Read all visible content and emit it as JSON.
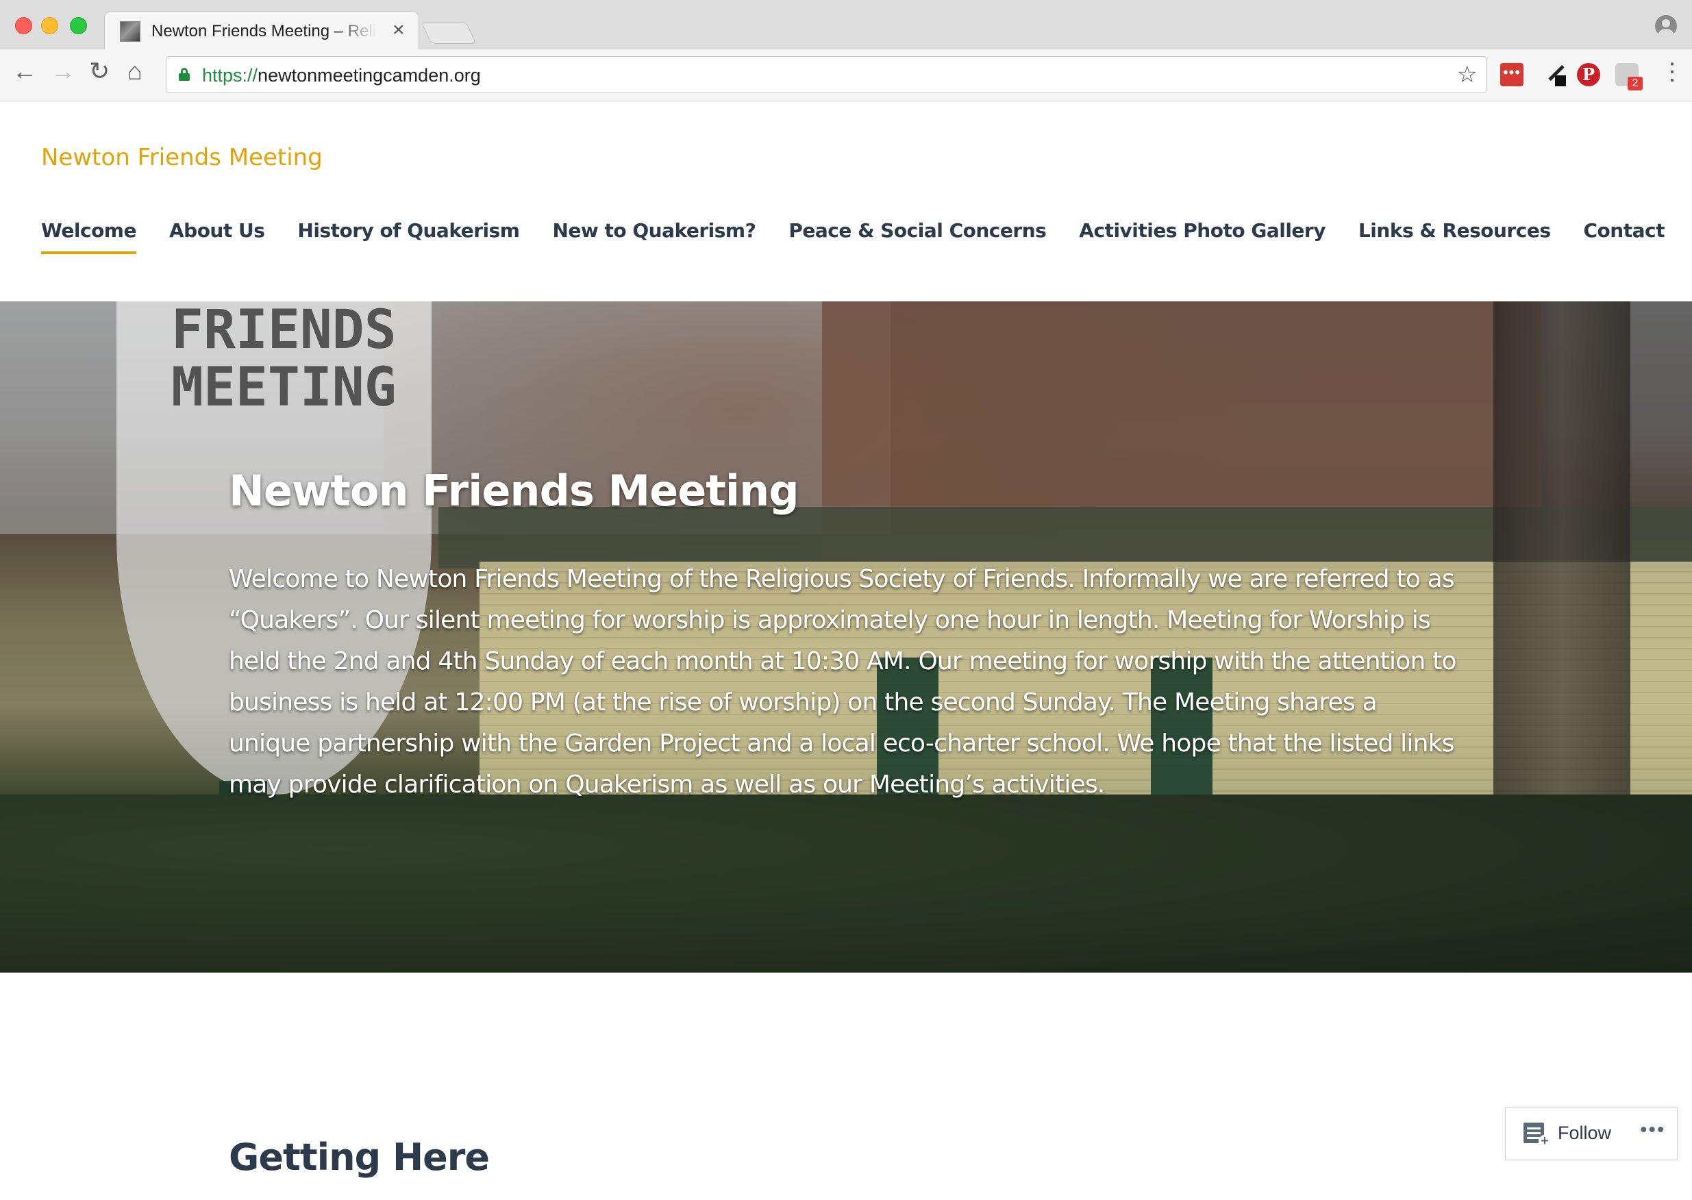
{
  "browser": {
    "tab_title": "Newton Friends Meeting – Religious Society of Friends",
    "tab_close": "×",
    "url_scheme": "https://",
    "url_host": "newtonmeetingcamden.org",
    "extensions": {
      "lastpass_label": "•••",
      "pinterest_label": "P",
      "badge_count": "2"
    },
    "icons": [
      "back-icon",
      "forward-icon",
      "reload-icon",
      "home-icon",
      "lock-icon",
      "star-icon",
      "menu-icon",
      "profile-icon"
    ]
  },
  "site": {
    "title": "Newton Friends Meeting",
    "accent_color": "#e5a206",
    "nav": [
      {
        "label": "Welcome",
        "active": true
      },
      {
        "label": "About Us"
      },
      {
        "label": "History of Quakerism"
      },
      {
        "label": "New to Quakerism?"
      },
      {
        "label": "Peace & Social Concerns"
      },
      {
        "label": "Activities Photo Gallery"
      },
      {
        "label": "Links & Resources"
      },
      {
        "label": "Contact"
      }
    ]
  },
  "hero": {
    "sign_text": "FRIENDS\nMEETING",
    "heading": "Newton Friends Meeting",
    "body": "Welcome to Newton Friends Meeting of the Religious Society of Friends. Informally we are referred to as “Quakers”. Our silent meeting for worship is approximately one hour in length. Meeting for Worship is held the 2nd and 4th Sunday of each month at 10:30 AM. Our meeting for worship with the attention to business is held at 12:00 PM (at the rise of worship) on the second Sunday.  The Meeting shares a unique partnership with the Garden Project and a local eco-charter school. We hope that the listed links may provide clarification on Quakerism as well as our Meeting’s activities."
  },
  "section": {
    "heading": "Getting Here"
  },
  "follow_widget": {
    "label": "Follow",
    "more": "•••"
  }
}
